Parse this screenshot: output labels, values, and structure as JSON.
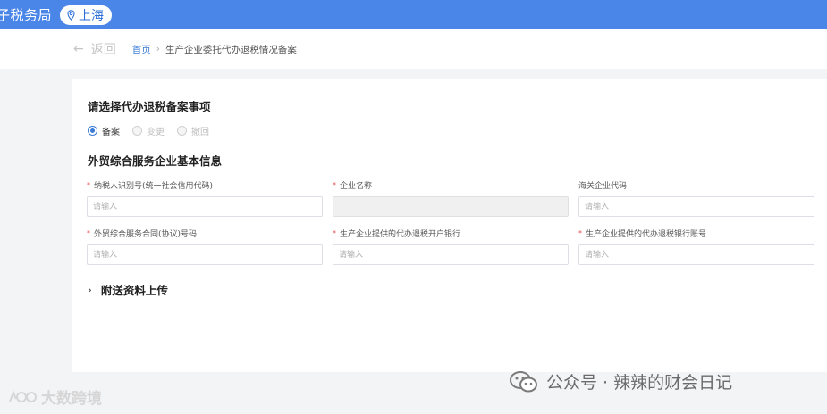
{
  "header": {
    "app_title": "子税务局",
    "region": "上海"
  },
  "nav": {
    "back_label": "返回",
    "breadcrumb_home": "首页",
    "breadcrumb_sep": "›",
    "breadcrumb_current": "生产企业委托代办退税情况备案"
  },
  "form": {
    "select_title": "请选择代办退税备案事项",
    "options": [
      {
        "label": "备案",
        "checked": true
      },
      {
        "label": "变更",
        "checked": false
      },
      {
        "label": "撤回",
        "checked": false
      }
    ],
    "basic_title": "外贸综合服务企业基本信息",
    "fields": [
      {
        "label": "纳税人识别号(统一社会信用代码)",
        "required": true,
        "placeholder": "请输入",
        "disabled": false
      },
      {
        "label": "企业名称",
        "required": true,
        "placeholder": "",
        "disabled": true
      },
      {
        "label": "海关企业代码",
        "required": false,
        "placeholder": "请输入",
        "disabled": false
      },
      {
        "label": "外贸综合服务合同(协议)号码",
        "required": true,
        "placeholder": "请输入",
        "disabled": false
      },
      {
        "label": "生产企业提供的代办退税开户银行",
        "required": true,
        "placeholder": "请输入",
        "disabled": false
      },
      {
        "label": "生产企业提供的代办退税银行账号",
        "required": true,
        "placeholder": "请输入",
        "disabled": false
      }
    ],
    "required_mark": "*",
    "attach_title": "附送资料上传",
    "attach_chevron": "›"
  },
  "watermark": {
    "right_text": "公众号 · 辣辣的财会日记",
    "left_text": "大数跨境"
  },
  "colors": {
    "topbar": "#4a86e8",
    "accent": "#3a7bd5"
  }
}
